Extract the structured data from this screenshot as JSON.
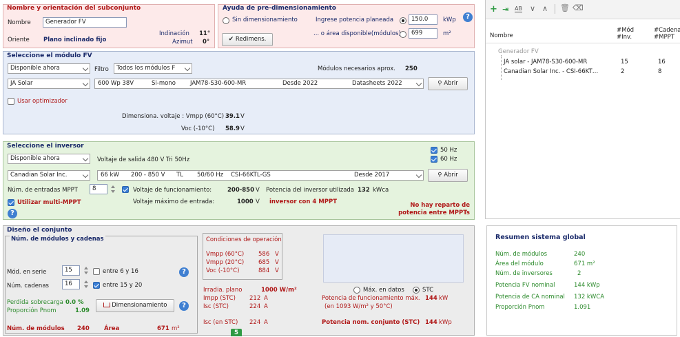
{
  "subassembly": {
    "title": "Nombre y orientación del subconjunto",
    "name_label": "Nombre",
    "name_value": "Generador FV",
    "orient_label": "Oriente",
    "orient_value": "Plano inclinado fijo",
    "tilt_label": "Indinación",
    "tilt_value": "11°",
    "azimuth_label": "Azimut",
    "azimuth_value": "0°"
  },
  "presizing": {
    "title": "Ayuda de pre-dimensionamiento",
    "no_sizing_label": "Sin dimensionamiento",
    "power_label": "Ingrese potencia planeada",
    "power_value": "150.0",
    "power_unit": "kWp",
    "area_label": "... o área disponible(módulos)",
    "area_value": "699",
    "area_unit": "m²",
    "resize_button": "Redimens."
  },
  "module": {
    "title": "Seleccione el módulo FV",
    "availability": "Disponible ahora",
    "filter_label": "Filtro",
    "filter_value": "Todos los módulos F",
    "needed_label": "Módulos necesarios aprox.",
    "needed_value": "250",
    "manufacturer": "JA Solar",
    "model_power": "600 Wp 38V",
    "model_tech": "Si-mono",
    "model_name": "JAM78-S30-600-MR",
    "model_since": "Desde 2022",
    "model_source": "Datasheets 2022",
    "open_button": "Abrir",
    "optimizer_label": "Usar optimizador",
    "sizing_label": "Dimensiona. voltaje : Vmpp (60°C)",
    "vmpp_value": "39.1",
    "vmpp_unit": "V",
    "voc_label": "Voc (-10°C)",
    "voc_value": "58.9",
    "voc_unit": "V"
  },
  "inverter": {
    "title": "Seleccione el inversor",
    "availability": "Disponible ahora",
    "output_label": "Voltaje de salida 480 V Tri 50Hz",
    "hz50_label": "50 Hz",
    "hz60_label": "60 Hz",
    "manufacturer": "Canadian Solar Inc.",
    "model_power": "66 kW",
    "model_range": "200 - 850 V",
    "model_tl": "TL",
    "model_freq": "50/60 Hz",
    "model_name": "CSI-66KTL-GS",
    "model_since": "Desde 2017",
    "open_button": "Abrir",
    "mppt_inputs_label": "Núm. de entradas MPPT",
    "mppt_inputs_value": "8",
    "op_voltage_label": "Voltaje de funcionamiento:",
    "op_voltage_value": "200-850",
    "op_voltage_unit": "V",
    "inv_power_label": "Potencia del inversor utilizada",
    "inv_power_value": "132",
    "inv_power_unit": "kWca",
    "multi_mppt_label": "Utilizar multi-MPPT",
    "max_input_label": "Voltaje máximo de entrada:",
    "max_input_value": "1000",
    "max_input_unit": "V",
    "mppt_note": "inversor con 4 MPPT",
    "warning_line1": "No hay reparto de",
    "warning_line2": "potencia entre MPPTs"
  },
  "design": {
    "title": "Diseño el conjunto",
    "strings_title": "Núm. de módulos y cadenas",
    "series_label": "Mód. en serie",
    "series_value": "15",
    "series_range": "entre 6 y 16",
    "strings_label": "Núm. cadenas",
    "strings_value": "16",
    "strings_range": "entre 15 y 20",
    "overload_label": "Perdida sobrecarga",
    "overload_value": "0.0 %",
    "ratio_label": "Proporción Pnom",
    "ratio_value": "1.09",
    "sizing_button": "Dimensionamiento",
    "n_modules_label": "Núm. de módulos",
    "n_modules_value": "240",
    "area_label": "Área",
    "area_value": "671",
    "area_unit": "m²",
    "op_cond_title": "Condiciones de operación",
    "vmpp60_label": "Vmpp (60°C)",
    "vmpp60_value": "586",
    "vmpp20_label": "Vmpp (20°C)",
    "vmpp20_value": "685",
    "voc_label": "Voc (-10°C)",
    "voc_value": "884",
    "volt_unit": "V",
    "irrad_label": "Irradia. plano",
    "irrad_value": "1000 W/m²",
    "max_data_label": "Máx. en datos",
    "stc_label": "STC",
    "impp_label": "Impp (STC)",
    "impp_value": "212",
    "amp_unit": "A",
    "max_op_power_label": "Potencia de funcionamiento máx.",
    "max_op_power_value": "144",
    "max_op_power_unit": "kW",
    "isc_label": "Isc (STC)",
    "isc_value": "224",
    "conditions_note": "(en 1093 W/m² y 50°C)",
    "isc_at_label": "Isc (en STC)",
    "isc_at_value": "224",
    "nominal_label": "Potencia nom. conjunto (STC)",
    "nominal_value": "144",
    "nominal_unit": "kWp",
    "badge": "5"
  },
  "tree": {
    "col_name": "Nombre",
    "col_nmod_1": "#Mód",
    "col_nmod_2": "#Inv.",
    "col_chain_1": "#Cadena",
    "col_chain_2": "#MPPT",
    "group": "Generador FV",
    "rows": [
      {
        "name": "JA solar - JAM78-S30-600-MR",
        "a": "15",
        "b": "16"
      },
      {
        "name": "Canadian Solar Inc. - CSI-66KT…",
        "a": "2",
        "b": "8"
      }
    ]
  },
  "summary": {
    "title": "Resumen sistema global",
    "rows": [
      {
        "label": "Núm. de módulos",
        "value": "240"
      },
      {
        "label": "Área del módulo",
        "value": "671 m²"
      },
      {
        "label": "Núm. de inversores",
        "value": "2"
      },
      {
        "label": "Potencia FV nominal",
        "value": "144 kWp"
      },
      {
        "label": "Potencia de CA nominal",
        "value": "132 kWCA"
      },
      {
        "label": "Proporción Pnom",
        "value": "1.091"
      }
    ]
  }
}
